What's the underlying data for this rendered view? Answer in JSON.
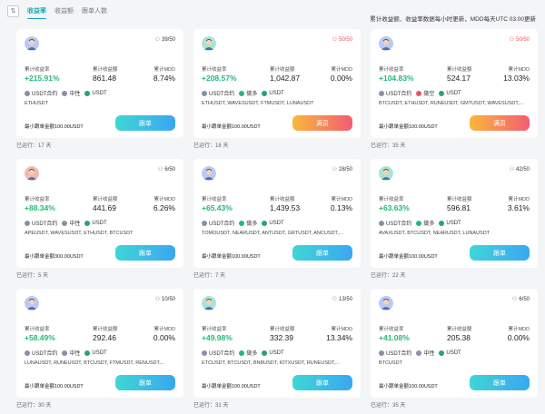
{
  "tabs": [
    "收益率",
    "收益额",
    "跟单人数"
  ],
  "active_tab": 0,
  "notice": "累计收益额、收益率数据每小时更新，MDD每天UTC 03:00更新",
  "labels": {
    "return_rate": "累计收益率",
    "profit": "累计收益额",
    "mdd": "累计MDD"
  },
  "cards": [
    {
      "seats": "39/50",
      "full": false,
      "rate": "+215.91%",
      "profit": "861.48",
      "mdd": "8.74%",
      "tags": [
        {
          "icon": "usdtc",
          "text": "USDT合约"
        },
        {
          "icon": "neutral",
          "text": "中性"
        },
        {
          "icon": "usdt",
          "text": "USDT"
        }
      ],
      "pairs": "ETHUSDT",
      "min": "最小跟单金额100.00USDT",
      "button": "跟单",
      "runtime": "已运行：17 天",
      "avatar_color": "#b9c9f2"
    },
    {
      "seats": "50/50",
      "full": true,
      "rate": "+208.57%",
      "profit": "1,042.87",
      "mdd": "0.00%",
      "tags": [
        {
          "icon": "usdtc",
          "text": "USDT合约"
        },
        {
          "icon": "long",
          "text": "做多"
        },
        {
          "icon": "usdt",
          "text": "USDT"
        }
      ],
      "pairs": "ETHUSDT, WAVESUSDT, FTMUSDT, LUNAUSDT",
      "min": "最小跟单金额100.00USDT",
      "button": "满员",
      "runtime": "已运行：18 天",
      "avatar_color": "#a9e3d6"
    },
    {
      "seats": "50/50",
      "full": true,
      "rate": "+104.83%",
      "profit": "524.17",
      "mdd": "13.03%",
      "tags": [
        {
          "icon": "usdtc",
          "text": "USDT合约"
        },
        {
          "icon": "short",
          "text": "做空"
        },
        {
          "icon": "usdt",
          "text": "USDT"
        }
      ],
      "pairs": "BTCUSDT, ETHUSDT, RUNEUSDT, GMTUSDT, WAVESUSDT,...",
      "min": "最小跟单金额100.00USDT",
      "button": "满员",
      "runtime": "已运行：35 天",
      "avatar_color": "#b9c9f2"
    },
    {
      "seats": "6/50",
      "full": false,
      "rate": "+88.34%",
      "profit": "441.69",
      "mdd": "6.26%",
      "tags": [
        {
          "icon": "usdtc",
          "text": "USDT合约"
        },
        {
          "icon": "neutral",
          "text": "中性"
        },
        {
          "icon": "usdt",
          "text": "USDT"
        }
      ],
      "pairs": "APEUSDT, WAVESUSDT, ETHUSDT, BTCUSDT",
      "min": "最小跟单金额300.00USDT",
      "button": "跟单",
      "runtime": "已运行：5 天",
      "avatar_color": "#f5b8b0"
    },
    {
      "seats": "28/50",
      "full": false,
      "rate": "+65.43%",
      "profit": "1,439.53",
      "mdd": "0.13%",
      "tags": [
        {
          "icon": "usdtc",
          "text": "USDT合约"
        },
        {
          "icon": "long",
          "text": "做多"
        },
        {
          "icon": "usdt",
          "text": "USDT"
        }
      ],
      "pairs": "TOMOUSDT, NEARUSDT, ANTUSDT, GRTUSDT, ANCUSDT,...",
      "min": "最小跟单金额100.00USDT",
      "button": "跟单",
      "runtime": "已运行：7 天",
      "avatar_color": "#b9c9f2"
    },
    {
      "seats": "42/50",
      "full": false,
      "rate": "+63.63%",
      "profit": "596.81",
      "mdd": "3.61%",
      "tags": [
        {
          "icon": "usdtc",
          "text": "USDT合约"
        },
        {
          "icon": "long",
          "text": "做多"
        },
        {
          "icon": "usdt",
          "text": "USDT"
        }
      ],
      "pairs": "AVAXUSDT, BTCUSDT, NEARUSDT, LUNAUSDT",
      "min": "最小跟单金额100.00USDT",
      "button": "跟单",
      "runtime": "已运行：22 天",
      "avatar_color": "#a9e3d6"
    },
    {
      "seats": "10/50",
      "full": false,
      "rate": "+58.49%",
      "profit": "292.46",
      "mdd": "0.00%",
      "tags": [
        {
          "icon": "usdtc",
          "text": "USDT合约"
        },
        {
          "icon": "neutral",
          "text": "中性"
        },
        {
          "icon": "usdt",
          "text": "USDT"
        }
      ],
      "pairs": "LUNAUSDT, RUNEUSDT, BTCUSDT, FTMUSDT, RENUSDT,...",
      "min": "最小跟单金额100.00USDT",
      "button": "跟单",
      "runtime": "已运行：30 天",
      "avatar_color": "#b9c9f2"
    },
    {
      "seats": "13/50",
      "full": false,
      "rate": "+49.98%",
      "profit": "332.39",
      "mdd": "13.34%",
      "tags": [
        {
          "icon": "usdtc",
          "text": "USDT合约"
        },
        {
          "icon": "long",
          "text": "做多"
        },
        {
          "icon": "usdt",
          "text": "USDT"
        }
      ],
      "pairs": "ETCUSDT, BTCUSDT, BNBUSDT, IOTXUSDT, RUNEUSDT,...",
      "min": "最小跟单金额100.00USDT",
      "button": "跟单",
      "runtime": "已运行：31 天",
      "avatar_color": "#a9e3d6"
    },
    {
      "seats": "6/50",
      "full": false,
      "rate": "+41.08%",
      "profit": "205.38",
      "mdd": "0.00%",
      "tags": [
        {
          "icon": "usdtc",
          "text": "USDT合约"
        },
        {
          "icon": "neutral",
          "text": "中性"
        },
        {
          "icon": "usdt",
          "text": "USDT"
        }
      ],
      "pairs": "BTCUSDT",
      "min": "最小跟单金额100.00USDT",
      "button": "跟单",
      "runtime": "已运行：35 天",
      "avatar_color": "#b9c9f2"
    }
  ]
}
